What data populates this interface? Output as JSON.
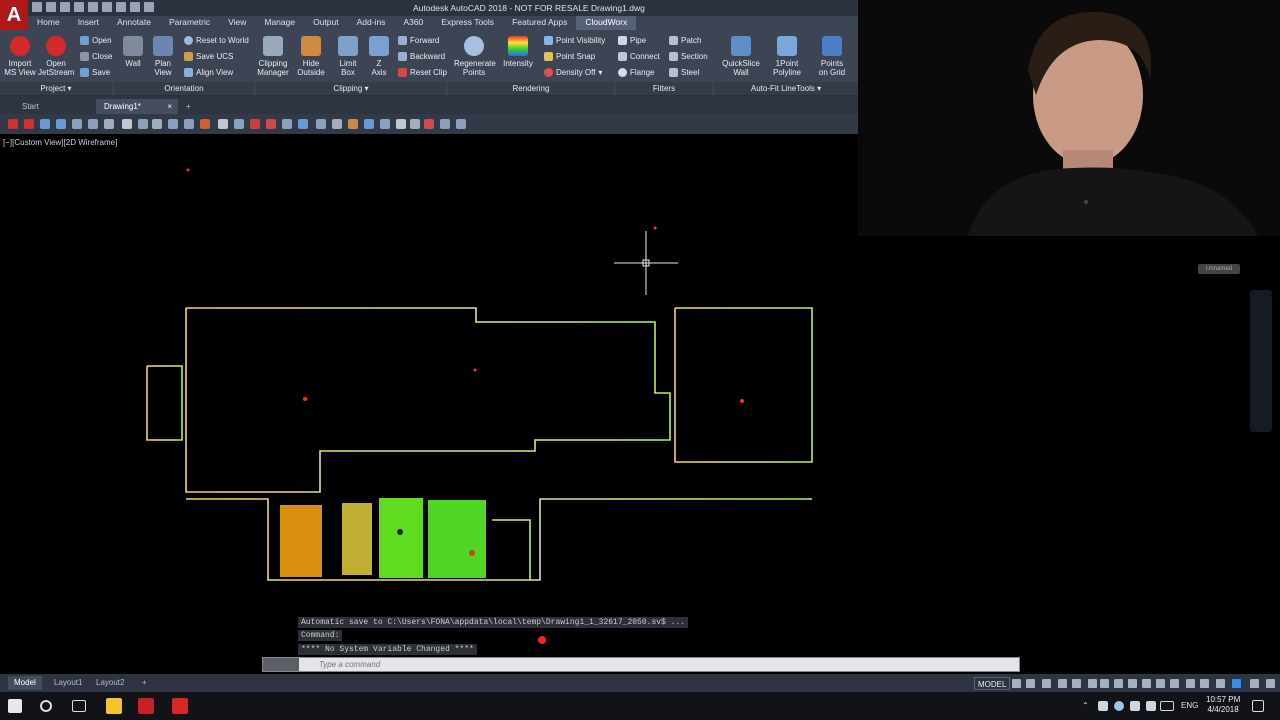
{
  "window": {
    "logo": "A",
    "title": "Autodesk AutoCAD 2018 - NOT FOR RESALE    Drawing1.dwg"
  },
  "ribbon_tabs": [
    "Home",
    "Insert",
    "Annotate",
    "Parametric",
    "View",
    "Manage",
    "Output",
    "Add-ins",
    "A360",
    "Express Tools",
    "Featured Apps",
    "CloudWorx"
  ],
  "ribbon": {
    "import_ms_view": [
      "Import",
      "MS View"
    ],
    "open_jetstream": [
      "Open",
      "JetStream"
    ],
    "open": "Open",
    "close": "Close",
    "save": "Save",
    "wall": "Wall",
    "plan_view": [
      "Plan",
      "View"
    ],
    "reset_to_world": "Reset to World",
    "save_ucs": "Save UCS",
    "align_view": "Align View",
    "clipping_manager": [
      "Clipping",
      "Manager"
    ],
    "hide_outside": [
      "Hide",
      "Outside"
    ],
    "limit_box": [
      "Limit",
      "Box"
    ],
    "z_axis": [
      "Z",
      "Axis"
    ],
    "forward": "Forward",
    "backward": "Backward",
    "reset_clip": "Reset Clip",
    "regenerate_points": [
      "Regenerate",
      "Points"
    ],
    "intensity": "Intensity",
    "point_visibility": "Point Visibility",
    "point_snap": "Point Snap",
    "density_off": "Density Off",
    "pipe": "Pipe",
    "connect": "Connect",
    "flange": "Flange",
    "patch": "Patch",
    "section": "Section",
    "steel": "Steel",
    "quickslice_wall": [
      "QuickSlice",
      "Wall"
    ],
    "onepoint_polyline": [
      "1Point",
      "Polyline"
    ],
    "points_on_grid": [
      "Points",
      "on Grid"
    ],
    "panels": {
      "project": "Project ▾",
      "orientation": "Orientation",
      "clipping": "Clipping ▾",
      "rendering": "Rendering",
      "fitters": "Fitters",
      "autofit": "Auto-Fit LineTools ▾"
    }
  },
  "doc_tabs": {
    "start": "Start",
    "drawing": "Drawing1*",
    "close": "×",
    "add": "+"
  },
  "viewport_label": "[−][Custom View][2D Wireframe]",
  "ucs_badge": "Unnamed",
  "command": {
    "history": [
      "Automatic save to C:\\Users\\FONA\\appdata\\local\\temp\\Drawing1_1_32617_2050.sv$ ...",
      "Command:",
      "**** No System Variable Changed ****"
    ],
    "placeholder": "Type a command"
  },
  "status": {
    "tabs": [
      "Model",
      "Layout1",
      "Layout2"
    ],
    "add": "+",
    "model_button": "MODEL"
  },
  "taskbar": {
    "lang": "ENG",
    "time": "10:57 PM",
    "date": "4/4/2018"
  },
  "colors": {
    "acad_red": "#b01818",
    "ribbon_bg": "#3d4554",
    "cloud_green": "#5fdc1f",
    "cloud_yellow": "#f2d94a",
    "cloud_orange": "#f0a010"
  }
}
